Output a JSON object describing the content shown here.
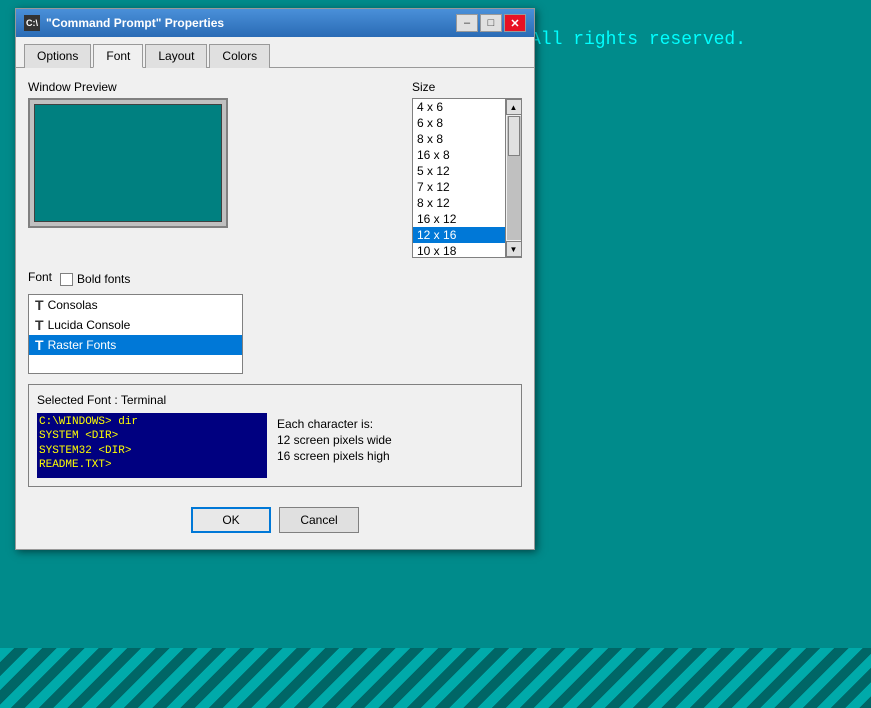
{
  "background": {
    "text": "All rights reserved.",
    "color": "#00FFFF"
  },
  "dialog": {
    "title": "\"Command Prompt\" Properties",
    "title_icon": "C:\\",
    "tabs": [
      {
        "id": "options",
        "label": "Options",
        "active": false
      },
      {
        "id": "font",
        "label": "Font",
        "active": true
      },
      {
        "id": "layout",
        "label": "Layout",
        "active": false
      },
      {
        "id": "colors",
        "label": "Colors",
        "active": false
      }
    ],
    "window_preview_label": "Window Preview",
    "size_label": "Size",
    "size_items": [
      {
        "label": "4 x 6",
        "selected": false
      },
      {
        "label": "6 x 8",
        "selected": false
      },
      {
        "label": "8 x 8",
        "selected": false
      },
      {
        "label": "16 x 8",
        "selected": false
      },
      {
        "label": "5 x 12",
        "selected": false
      },
      {
        "label": "7 x 12",
        "selected": false
      },
      {
        "label": "8 x 12",
        "selected": false
      },
      {
        "label": "16 x 12",
        "selected": false
      },
      {
        "label": "12 x 16",
        "selected": true
      },
      {
        "label": "10 x 18",
        "selected": false
      }
    ],
    "font_label": "Font",
    "bold_fonts_label": "Bold fonts",
    "font_items": [
      {
        "label": "Consolas",
        "selected": false,
        "icon": "T"
      },
      {
        "label": "Lucida Console",
        "selected": false,
        "icon": "T"
      },
      {
        "label": "Raster Fonts",
        "selected": true,
        "icon": "T"
      }
    ],
    "selected_font_label": "Selected Font : Terminal",
    "terminal_preview_lines": [
      "C:\\WINDOWS> dir",
      "SYSTEM          <DIR>",
      "SYSTEM32        <DIR>",
      "README.TXT>"
    ],
    "char_info_title": "Each character is:",
    "char_info_width": "12 screen pixels wide",
    "char_info_height": "16 screen pixels high",
    "ok_label": "OK",
    "cancel_label": "Cancel",
    "close_label": "✕",
    "minimize_label": "–",
    "maximize_label": "□"
  }
}
